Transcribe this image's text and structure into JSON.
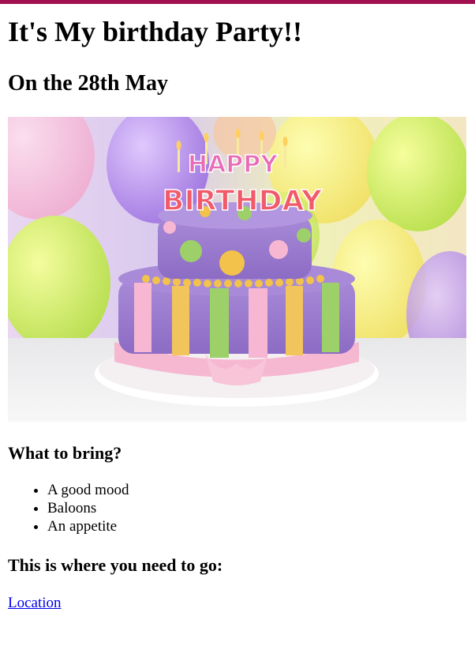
{
  "page": {
    "title": "It's My birthday Party!!",
    "subtitle": "On the 28th May"
  },
  "hero_image": {
    "cake_lettering_top": "HAPPY",
    "cake_lettering_bottom": "BIRTHDAY"
  },
  "bring_section": {
    "heading": "What to bring?",
    "items": [
      "A good mood",
      "Baloons",
      "An appetite"
    ]
  },
  "where_section": {
    "heading": "This is where you need to go:",
    "link_label": "Location"
  },
  "colors": {
    "top_bar": "#a0104e",
    "link": "#0000ee"
  }
}
